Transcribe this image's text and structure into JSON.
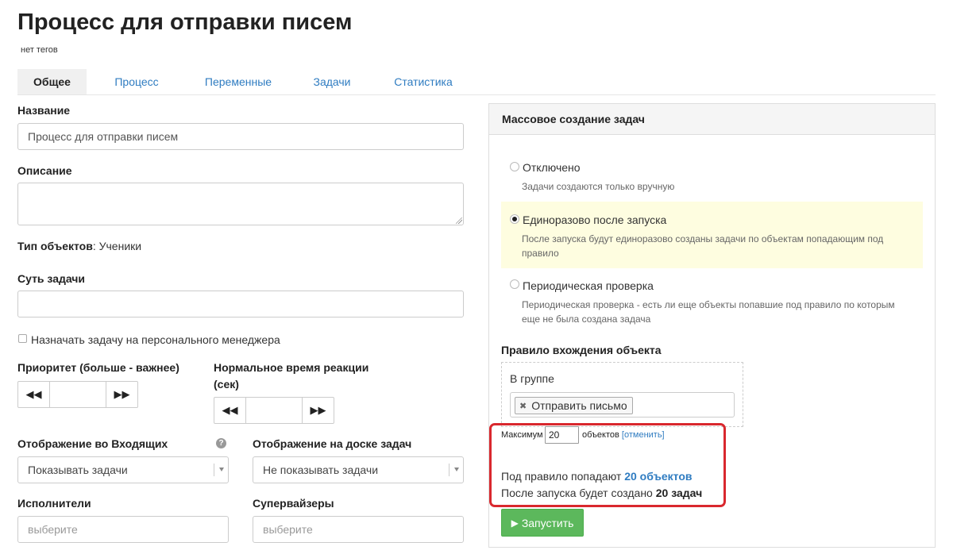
{
  "page": {
    "title": "Процесс для отправки писем",
    "tags": "нет тегов"
  },
  "tabs": [
    {
      "label": "Общее",
      "active": true
    },
    {
      "label": "Процесс",
      "active": false
    },
    {
      "label": "Переменные",
      "active": false
    },
    {
      "label": "Задачи",
      "active": false
    },
    {
      "label": "Статистика",
      "active": false
    }
  ],
  "form": {
    "name_label": "Название",
    "name_value": "Процесс для отправки писем",
    "description_label": "Описание",
    "description_value": "",
    "object_type_label": "Тип объектов",
    "object_type_value": ": Ученики",
    "essence_label": "Суть задачи",
    "essence_value": "",
    "assign_manager_label": "Назначать задачу на персонального менеджера",
    "assign_manager_checked": false,
    "priority_label": "Приоритет (больше - важнее)",
    "priority_value": "",
    "reaction_label_line1": "Нормальное время реакции",
    "reaction_label_line2": "(сек)",
    "reaction_value": "",
    "inbox_label": "Отображение во Входящих",
    "inbox_value": "Показывать задачи",
    "board_label": "Отображение на доске задач",
    "board_value": "Не показывать задачи",
    "executors_label": "Исполнители",
    "executors_placeholder": "выберите",
    "supervisors_label": "Супервайзеры",
    "supervisors_placeholder": "выберите"
  },
  "icons": {
    "rewind": "◀◀",
    "forward": "▶▶",
    "help": "?",
    "remove": "✖",
    "play": "▶"
  },
  "panel": {
    "title": "Массовое создание задач",
    "options": [
      {
        "title": "Отключено",
        "desc": "Задачи создаются только вручную",
        "selected": false
      },
      {
        "title": "Единоразово после запуска",
        "desc": "После запуска будут единоразово созданы задачи по объектам попадающим под правило",
        "selected": true
      },
      {
        "title": "Периодическая проверка",
        "desc": "Периодическая проверка - есть ли еще объекты попавшие под правило по которым еще не была создана задача",
        "selected": false
      }
    ],
    "rule_label": "Правило вхождения объекта",
    "group_label": "В группе",
    "group_chip": "Отправить письмо",
    "max_label": "Максимум",
    "max_value": "20",
    "objects_label": "объектов",
    "cancel_link": "[отменить]",
    "summary_line1_prefix": "Под правило попадают",
    "summary_line1_value": "20 объектов",
    "summary_line2_prefix": "После запуска будет создано",
    "summary_line2_value": "20 задач",
    "run_button": "Запустить"
  },
  "colors": {
    "accent": "#2f7cc1",
    "success": "#5cb85c",
    "highlight": "#fefde0",
    "annotation": "#d9282e"
  }
}
